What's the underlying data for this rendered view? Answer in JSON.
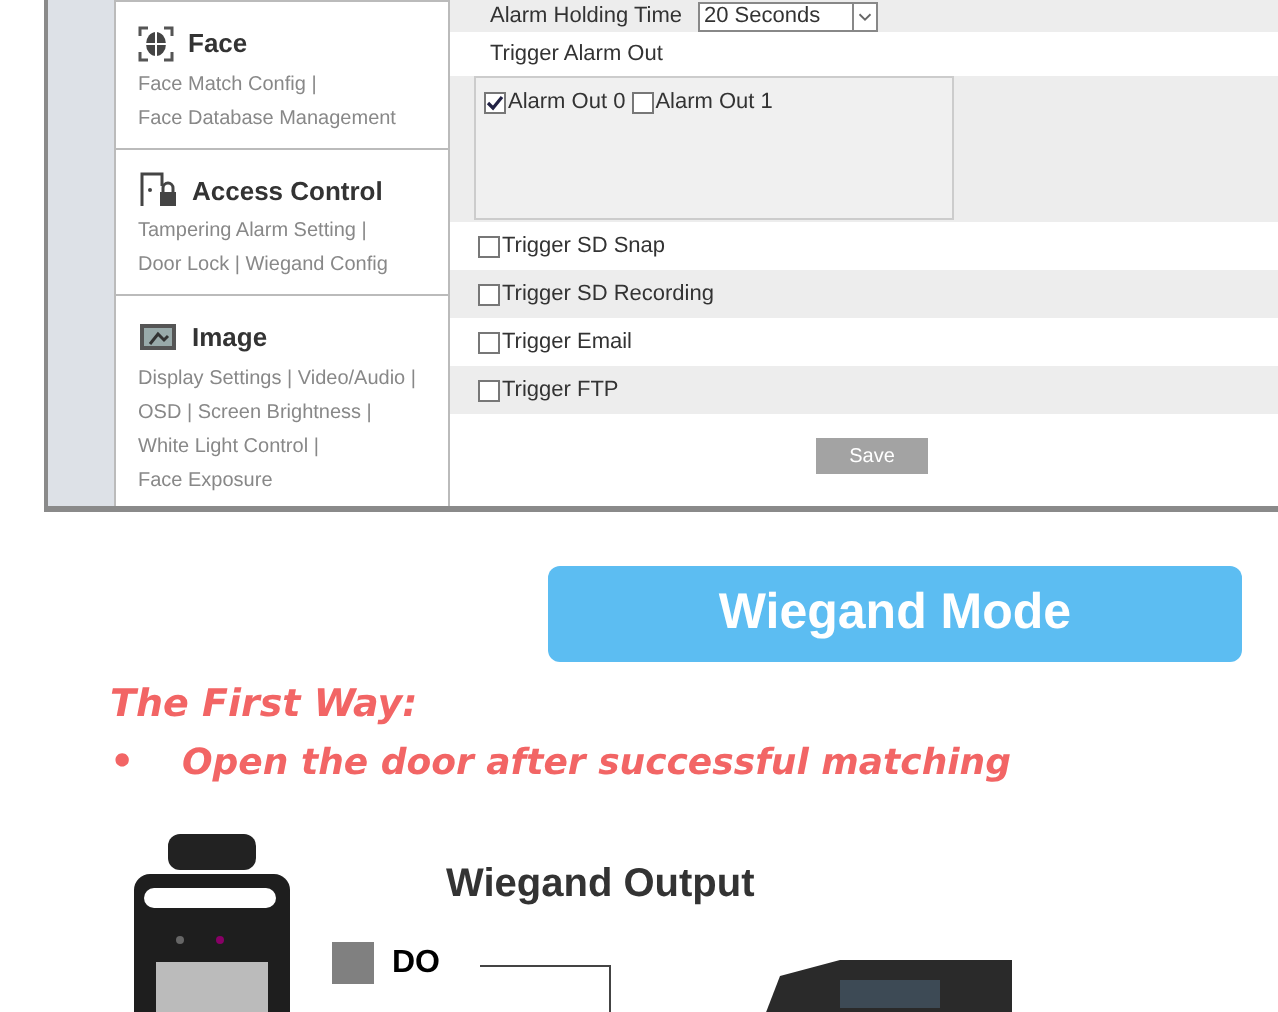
{
  "sidebar": {
    "sections": [
      {
        "kind": "face",
        "title": "Face",
        "links": [
          "Face Match Config |",
          "Face Database Management"
        ]
      },
      {
        "kind": "access",
        "title": "Access Control",
        "links": [
          "Tampering Alarm Setting |",
          "Door Lock | Wiegand Config"
        ]
      },
      {
        "kind": "image",
        "title": "Image",
        "links": [
          "Display Settings | Video/Audio |",
          "OSD | Screen Brightness |",
          "White Light Control |",
          "Face Exposure"
        ]
      }
    ]
  },
  "form": {
    "holding_time": {
      "label": "Alarm Holding Time",
      "value": "20 Seconds"
    },
    "alarm_out": {
      "label": "Trigger Alarm Out",
      "outputs": [
        {
          "label": "Alarm Out 0",
          "checked": true
        },
        {
          "label": "Alarm Out 1",
          "checked": false
        }
      ]
    },
    "triggers": [
      {
        "label": "Trigger SD Snap",
        "checked": false
      },
      {
        "label": "Trigger SD Recording",
        "checked": false
      },
      {
        "label": "Trigger Email",
        "checked": false
      },
      {
        "label": "Trigger FTP",
        "checked": false
      }
    ],
    "save": "Save"
  },
  "heading": "Wiegand Mode",
  "subheading": "The First Way:",
  "bullet": {
    "mark": "•",
    "text": "Open the door after successful matching"
  },
  "diagram": {
    "title": "Wiegand Output",
    "port": "DO"
  }
}
